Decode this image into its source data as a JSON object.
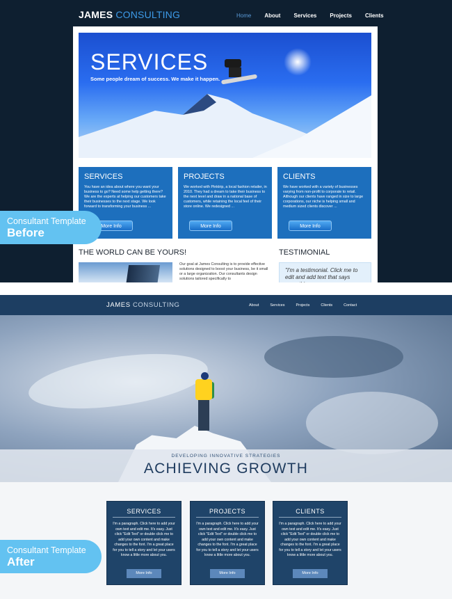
{
  "before": {
    "logo": {
      "brand": "JAMES",
      "accent": "CONSULTING"
    },
    "nav": [
      {
        "label": "Home",
        "active": true
      },
      {
        "label": "About"
      },
      {
        "label": "Services"
      },
      {
        "label": "Projects"
      },
      {
        "label": "Clients"
      }
    ],
    "hero": {
      "title": "SERVICES",
      "subtitle": "Some people dream of success. We make it happen."
    },
    "cards": [
      {
        "title": "SERVICES",
        "body": "You have an idea about where you want your business to go? Need some help getting there? We are the experts at helping our customers take their businesses to the next stage. We look forward to transforming your business ...",
        "button": "More Info"
      },
      {
        "title": "PROJECTS",
        "body": "We worked with Pinktrip, a local fashion retailer, in 2010. They had a dream to take their business to the next level and draw in a national base of customers, while retaining the local feel of their store online. We redesigned ...",
        "button": "More Info"
      },
      {
        "title": "CLIENTS",
        "body": "We have worked with a variety of businesses varying from non-profit to corporate to retail. Although our clients have ranged in size to large corporations, our niche is helping small and medium sized clients discover ...",
        "button": "More Info"
      }
    ],
    "section_world": "THE WORLD CAN BE YOURS!",
    "section_testimonial": "TESTIMONIAL",
    "about_text": "Our goal at James Consulting is to provide effective solutions designed to boost your business, be it small or a large organization. Our consultants design solutions tailored specifically to",
    "testimonial_text": "\"I'm a testimonial. Click me to edit and add text that says something"
  },
  "badges": {
    "before": {
      "line1": "Consultant Template",
      "line2": "Before"
    },
    "after": {
      "line1": "Consultant Template",
      "line2": "After"
    }
  },
  "after": {
    "logo": {
      "brand": "JAMES",
      "accent": "CONSULTING"
    },
    "nav": [
      "About",
      "Services",
      "Projects",
      "Clients",
      "Contact"
    ],
    "hero": {
      "kicker": "DEVELOPING INNOVATIVE STRATEGIES",
      "title": "ACHIEVING GROWTH"
    },
    "cards": [
      {
        "title": "SERVICES",
        "body": "I'm a paragraph. Click here to add your own text and edit me. It's easy. Just click \"Edit Text\" or double click me to add your own content and make changes to the font. I'm a great place for you to tell a story and let your users know a little more about you.",
        "button": "More Info"
      },
      {
        "title": "PROJECTS",
        "body": "I'm a paragraph. Click here to add your own text and edit me. It's easy. Just click \"Edit Text\" or double click me to add your own content and make changes to the font. I'm a great place for you to tell a story and let your users know a little more about you.",
        "button": "More Info"
      },
      {
        "title": "CLIENTS",
        "body": "I'm a paragraph. Click here to add your own text and edit me. It's easy. Just click \"Edit Text\" or double click me to add your own content and make changes to the font. I'm a great place for you to tell a story and let your users know a little more about you.",
        "button": "More Info"
      }
    ]
  },
  "colors": {
    "before_bg": "#0e1f30",
    "before_accent": "#3d9be9",
    "before_card": "#1d6fbd",
    "after_header": "#1d3e62",
    "after_card": "#1f4469",
    "badge": "#63c2f1"
  }
}
